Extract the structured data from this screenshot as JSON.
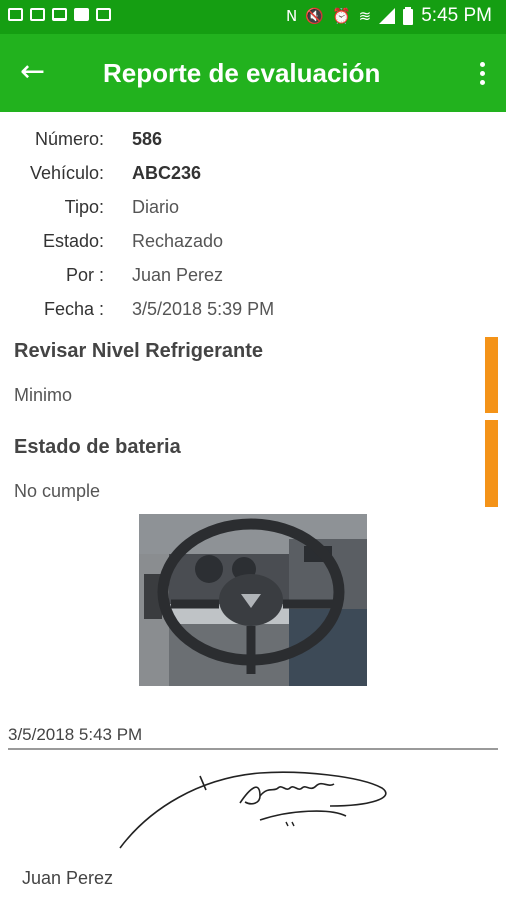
{
  "status_bar": {
    "time": "5:45 PM",
    "notification_icons": [
      "gallery-icon",
      "gmail-icon",
      "laptop-icon",
      "youtube-icon",
      "hd-icon"
    ],
    "system_icons": [
      "nfc-icon",
      "mute-icon",
      "alarm-icon",
      "wifi-icon",
      "signal-icon",
      "battery-icon"
    ]
  },
  "appbar": {
    "title": "Reporte de evaluación",
    "back_icon": "arrow-back-icon",
    "menu_icon": "more-vert-icon"
  },
  "report": {
    "fields": [
      {
        "label": "Número:",
        "value": "586",
        "bold": true
      },
      {
        "label": "Vehículo:",
        "value": "ABC236",
        "bold": true
      },
      {
        "label": "Tipo:",
        "value": "Diario",
        "bold": false
      },
      {
        "label": "Estado:",
        "value": "Rechazado",
        "bold": false
      },
      {
        "label": "Por :",
        "value": "Juan Perez",
        "bold": false
      },
      {
        "label": "Fecha :",
        "value": "3/5/2018 5:39 PM",
        "bold": false
      }
    ]
  },
  "items": [
    {
      "title": "Revisar Nivel Refrigerante",
      "value": "Minimo"
    },
    {
      "title": "Estado de bateria",
      "value": "No cumple"
    }
  ],
  "signature": {
    "date": "3/5/2018 5:43 PM",
    "name": "Juan Perez"
  },
  "colors": {
    "status_bar": "#159e12",
    "app_bar": "#22b21e",
    "item_indicator": "#f49318"
  }
}
